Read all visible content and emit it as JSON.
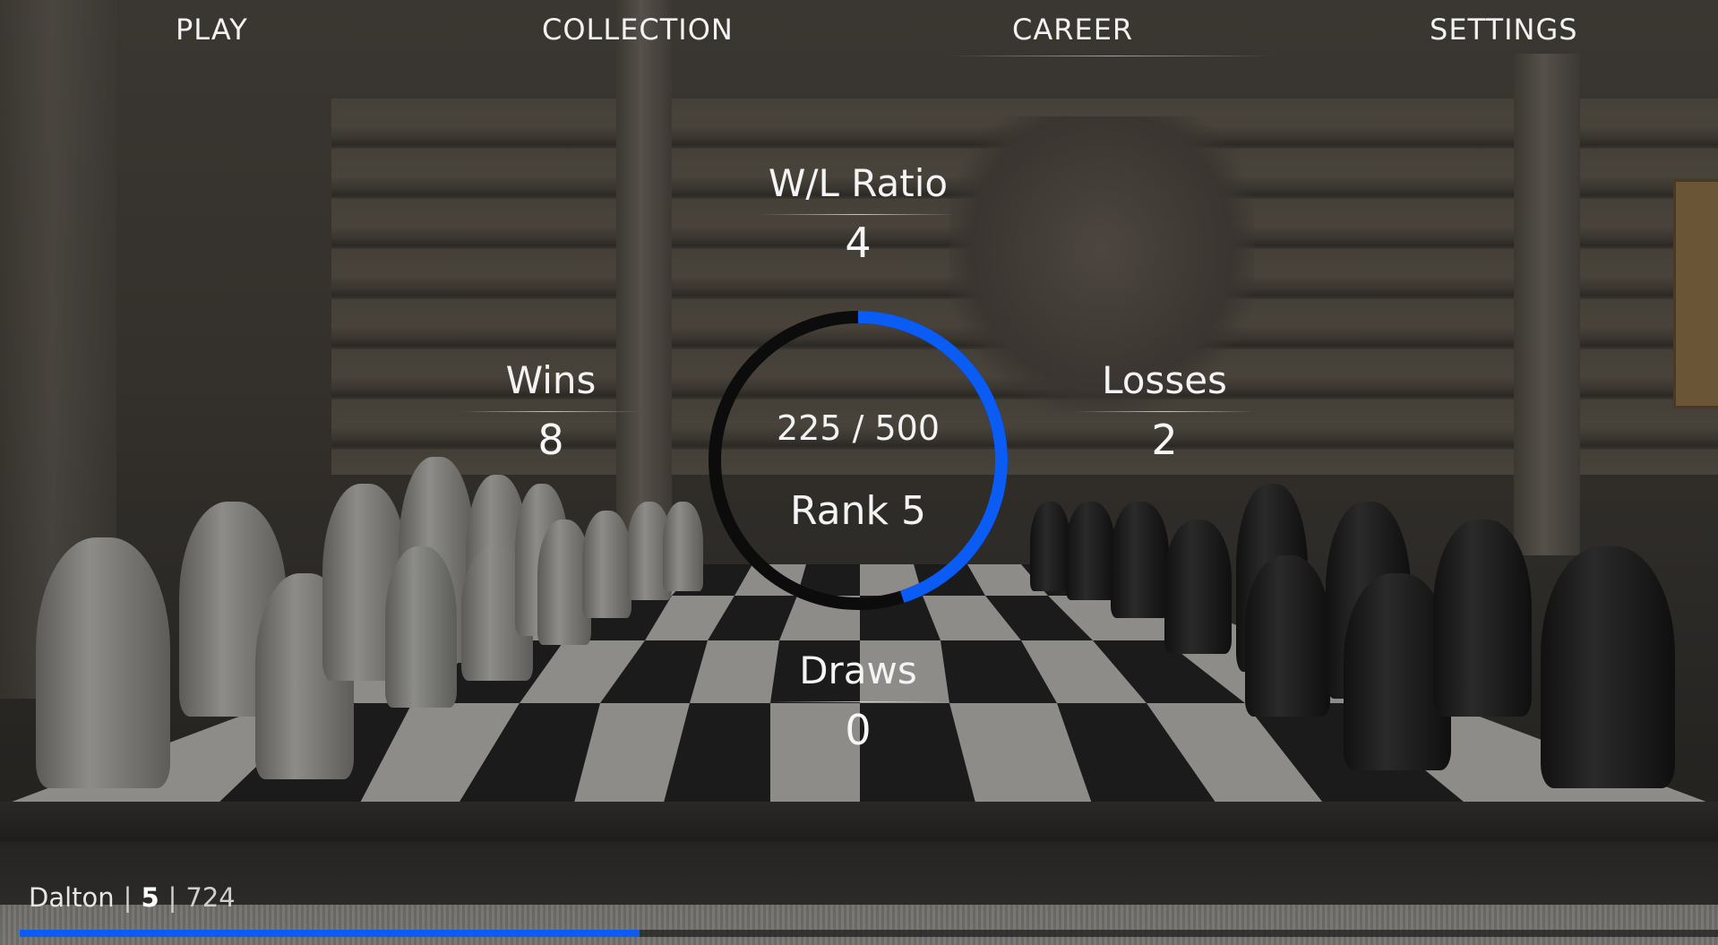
{
  "nav": {
    "items": [
      {
        "label": "PLAY"
      },
      {
        "label": "COLLECTION"
      },
      {
        "label": "CAREER"
      },
      {
        "label": "SETTINGS"
      }
    ],
    "active": "CAREER"
  },
  "stats": {
    "wl_ratio": {
      "label": "W/L Ratio",
      "value": "4"
    },
    "wins": {
      "label": "Wins",
      "value": "8"
    },
    "losses": {
      "label": "Losses",
      "value": "2"
    },
    "draws": {
      "label": "Draws",
      "value": "0"
    }
  },
  "rank_ring": {
    "xp_text": "225 / 500",
    "rank_text": "Rank 5",
    "progress_fraction": 0.45,
    "track_color": "#0c0c0c",
    "fill_color": "#0a5cf5"
  },
  "player": {
    "name": "Dalton",
    "separator": "|",
    "level": "5",
    "xp": "724",
    "xp_bar_fraction": 0.365,
    "bar_color": "#0a5cf5"
  }
}
